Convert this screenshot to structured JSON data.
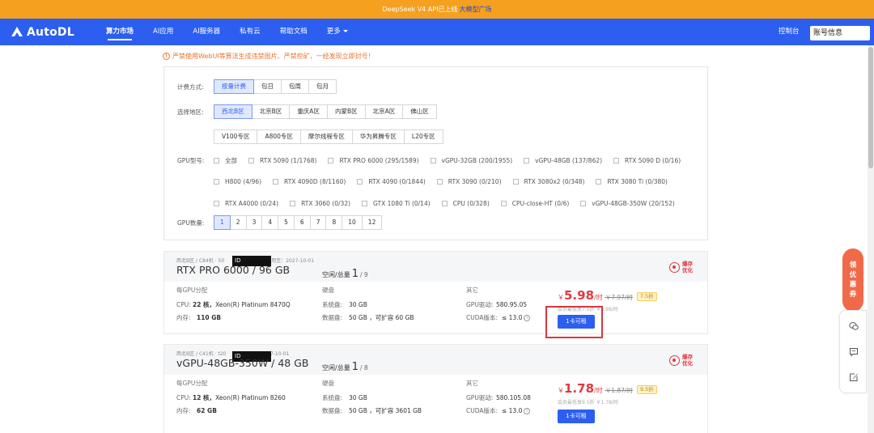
{
  "banner": {
    "text": "DeepSeek V4 API已上线",
    "link": "大模型广场"
  },
  "nav": {
    "logo": "AutoDL",
    "links": [
      {
        "label": "算力市场",
        "active": true
      },
      {
        "label": "AI应用"
      },
      {
        "label": "AI服务器"
      },
      {
        "label": "私有云"
      },
      {
        "label": "帮助文档"
      },
      {
        "label": "更多"
      }
    ],
    "console": "控制台",
    "account": "账号信息"
  },
  "warning": "严禁使用WebUI等算法生成违禁图片、严禁挖矿，一经发现立即封号！",
  "filters": {
    "billing": {
      "label": "计费方式:",
      "options": [
        "按量计费",
        "包日",
        "包周",
        "包月"
      ],
      "selected": 0
    },
    "region": {
      "label": "选择地区:",
      "options": [
        "西北B区",
        "北京B区",
        "重庆A区",
        "内蒙B区",
        "北京A区",
        "佛山区"
      ],
      "options2": [
        "V100专区",
        "A800专区",
        "摩尔线程专区",
        "华为昇腾专区",
        "L20专区"
      ],
      "selected": 0
    },
    "gpu_type": {
      "label": "GPU型号:",
      "rows": [
        [
          "全部",
          "RTX 5090 (1/1768)",
          "RTX PRO 6000 (295/1589)",
          "vGPU-32GB (200/1955)",
          "vGPU-48GB (137/862)",
          "RTX 5090 D (0/16)"
        ],
        [
          "H800 (4/96)",
          "RTX 4090D (8/1160)",
          "RTX 4090 (0/1844)",
          "RTX 3090 (0/210)",
          "RTX 3080x2 (0/348)",
          "RTX 3080 Ti (0/380)"
        ],
        [
          "RTX A4000 (0/24)",
          "RTX 3060 (0/32)",
          "GTX 1080 Ti (0/14)",
          "CPU (0/328)",
          "CPU-close-HT (0/6)",
          "vGPU-48GB-350W (20/152)"
        ]
      ]
    },
    "gpu_count": {
      "label": "GPU数量:",
      "options": [
        "1",
        "2",
        "3",
        "4",
        "5",
        "6",
        "7",
        "8",
        "10",
        "12"
      ],
      "selected": 0
    }
  },
  "cards": [
    {
      "meta_left": "西北B区 / C84机 · 50",
      "meta_right": "用至：2027-10-01",
      "redact": "ID",
      "gpu": "RTX PRO 6000 / 96 GB",
      "avail_label": "空闲/总量",
      "avail_free": "1",
      "avail_total": "/ 9",
      "promo": "爆存优化",
      "col1": {
        "hdr": "每GPU分配",
        "cpu_k": "CPU:",
        "cpu_num": "22 核，",
        "cpu_model": "Xeon(R) Platinum 8470Q",
        "mem_k": "内存:",
        "mem_v": "110 GB"
      },
      "col2": {
        "hdr": "硬盘",
        "sys_k": "系统盘:",
        "sys_v": "30 GB",
        "data_k": "数据盘:",
        "data_v": "50 GB ，可扩容 60 GB"
      },
      "col3": {
        "hdr": "其它",
        "drv_k": "GPU驱动:",
        "drv_v": "580.95.05",
        "cuda_k": "CUDA版本:",
        "cuda_v": "≤ 13.0"
      },
      "price": {
        "cur": "￥",
        "num": "5.98",
        "unit": "/时",
        "orig": "￥7.97/时",
        "disc": "7.5折",
        "min": "会员最低享7.5折 ￥5.98/时"
      },
      "rent": "1卡可租"
    },
    {
      "meta_left": "西北B区 / C41机 · t20",
      "meta_right": "用至：2027-10-01",
      "redact": "ID",
      "gpu": "vGPU-48GB-350W / 48 GB",
      "avail_label": "空闲/总量",
      "avail_free": "1",
      "avail_total": "/ 8",
      "promo": "爆存优化",
      "col1": {
        "hdr": "每GPU分配",
        "cpu_k": "CPU:",
        "cpu_num": "12 核，",
        "cpu_model": "Xeon(R) Platinum 8260",
        "mem_k": "内存:",
        "mem_v": "62 GB"
      },
      "col2": {
        "hdr": "硬盘",
        "sys_k": "系统盘:",
        "sys_v": "30 GB",
        "data_k": "数据盘:",
        "data_v": "50 GB ，可扩容 3601 GB"
      },
      "col3": {
        "hdr": "其它",
        "drv_k": "GPU驱动:",
        "drv_v": "580.105.08",
        "cuda_k": "CUDA版本:",
        "cuda_v": "≤ 13.0"
      },
      "price": {
        "cur": "￥",
        "num": "1.78",
        "unit": "/时",
        "orig": "￥1.87/时",
        "disc": "9.5折",
        "min": "会员最低享9.5折 ￥1.78/时"
      },
      "rent": "1卡可租"
    }
  ],
  "float": {
    "label": [
      "领",
      "优",
      "惠",
      "券"
    ]
  }
}
